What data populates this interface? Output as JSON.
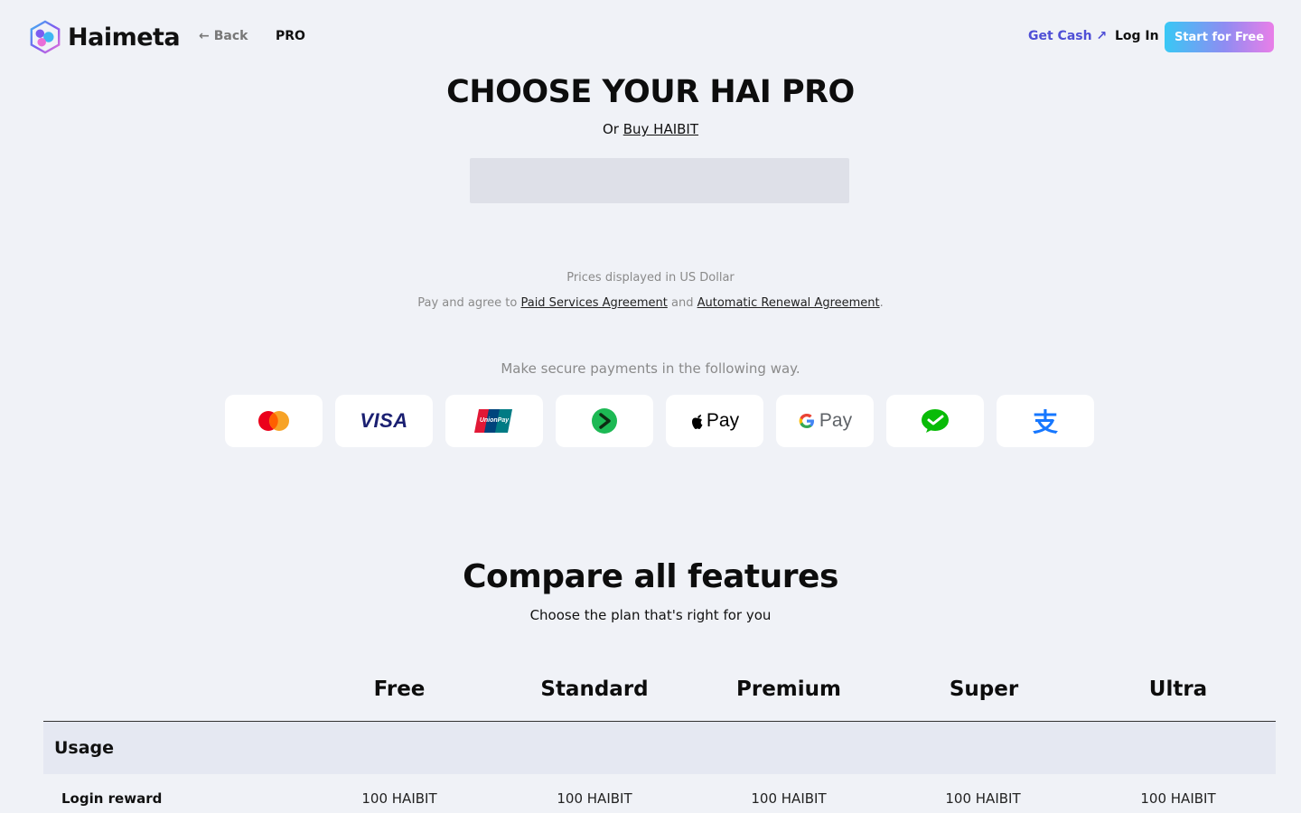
{
  "header": {
    "logo_text": "Haimeta",
    "back_label": "Back",
    "pro_label": "PRO",
    "get_cash_label": "Get Cash ↗",
    "login_label": "Log In",
    "start_label": "Start for Free"
  },
  "hero": {
    "title": "CHOOSE YOUR HAI PRO",
    "sub_prefix": "Or",
    "sub_link": "Buy HAIBIT",
    "prices_note": "Prices displayed in US Dollar",
    "agree_prefix": "Pay and agree to",
    "agree_link1": "Paid Services Agreement",
    "agree_mid": "and",
    "agree_link2": "Automatic Renewal Agreement",
    "agree_suffix": ".",
    "secure_note": "Make secure payments in the following way."
  },
  "payments": [
    {
      "icon": "mastercard-icon"
    },
    {
      "icon": "visa-icon",
      "text": "VISA"
    },
    {
      "icon": "unionpay-icon"
    },
    {
      "icon": "pay-arrow-icon"
    },
    {
      "icon": "apple-pay-icon",
      "text": "Pay"
    },
    {
      "icon": "google-pay-icon",
      "text": "Pay"
    },
    {
      "icon": "wechat-pay-icon"
    },
    {
      "icon": "alipay-icon",
      "text": "支"
    }
  ],
  "compare": {
    "title": "Compare all features",
    "subtitle": "Choose the plan that's right for you",
    "plans": [
      "Free",
      "Standard",
      "Premium",
      "Super",
      "Ultra"
    ],
    "section": "Usage",
    "rows": [
      {
        "label": "Login reward",
        "values": [
          "100 HAIBIT",
          "100 HAIBIT",
          "100 HAIBIT",
          "100 HAIBIT",
          "100 HAIBIT"
        ]
      }
    ]
  },
  "colors": {
    "background": "#f0f2f7",
    "accent": "#4f4fd6",
    "cta_gradient_start": "#38c8f5",
    "cta_gradient_end": "#e97ee8"
  }
}
